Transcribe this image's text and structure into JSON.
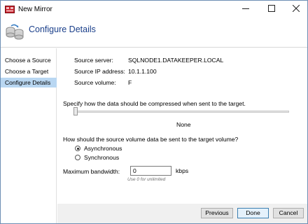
{
  "window": {
    "title": "New Mirror"
  },
  "header": {
    "title": "Configure Details"
  },
  "sidebar": {
    "items": [
      {
        "label": "Choose a Source"
      },
      {
        "label": "Choose a Target"
      },
      {
        "label": "Configure Details",
        "active": true
      }
    ]
  },
  "details": {
    "source_server_label": "Source server:",
    "source_server_value": "SQLNODE1.DATAKEEPER.LOCAL",
    "source_ip_label": "Source IP address:",
    "source_ip_value": "10.1.1.100",
    "source_volume_label": "Source volume:",
    "source_volume_value": "F"
  },
  "compression": {
    "prompt": "Specify how the data should be compressed when sent to the target.",
    "value": "None"
  },
  "transfer": {
    "prompt": "How should the source volume data be sent to the target volume?",
    "options": [
      {
        "label": "Asynchronous",
        "selected": true
      },
      {
        "label": "Synchronous",
        "selected": false
      }
    ]
  },
  "bandwidth": {
    "label": "Maximum bandwidth:",
    "value": "0",
    "unit": "kbps",
    "hint": "Use 0 for unlimited"
  },
  "footer": {
    "previous_label": "Previous",
    "done_label": "Done",
    "cancel_label": "Cancel"
  },
  "colors": {
    "header_title": "#1a3f8a",
    "nav_active_bg": "#b9d7f2",
    "footer_bg": "#f0f0f0",
    "default_button_border": "#3c7fb1"
  },
  "icons": {
    "app": "app-icon",
    "header": "mirror-volumes-icon",
    "minimize": "minimize-icon",
    "maximize": "maximize-icon",
    "close": "close-icon"
  }
}
